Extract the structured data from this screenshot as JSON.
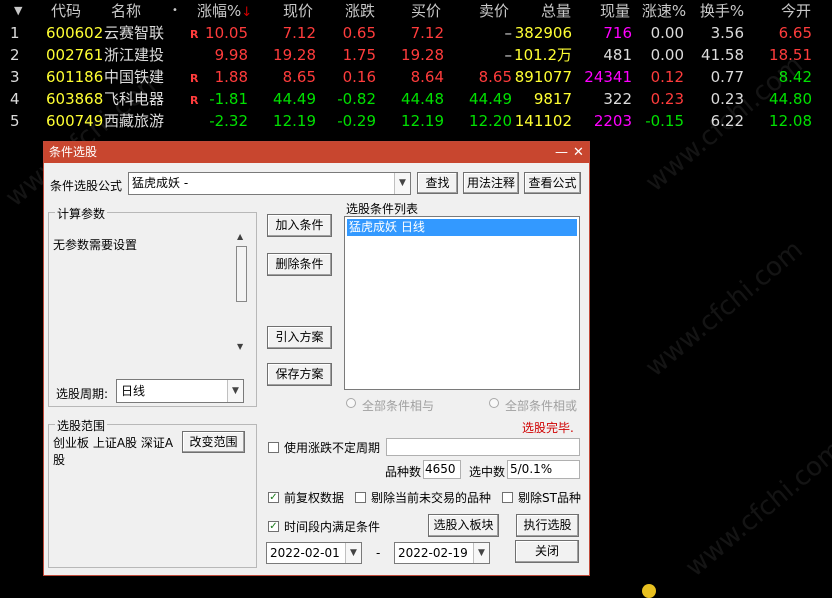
{
  "quote_table": {
    "headers": {
      "code": "代码",
      "name": "名称",
      "change_pct": "涨幅%",
      "price": "现价",
      "change": "涨跌",
      "bid": "买价",
      "ask": "卖价",
      "volume": "总量",
      "cur_vol": "现量",
      "speed": "涨速%",
      "turnover": "换手%",
      "open": "今开"
    },
    "sort_marker": "↓",
    "rows": [
      {
        "idx": "1",
        "code": "600602",
        "name": "云赛智联",
        "flag": "R",
        "change_pct": "10.05",
        "price": "7.12",
        "change": "0.65",
        "bid": "7.12",
        "ask": "–",
        "volume": "382906",
        "cur_vol": "716",
        "speed": "0.00",
        "turnover": "3.56",
        "open": "6.65"
      },
      {
        "idx": "2",
        "code": "002761",
        "name": "浙江建投",
        "flag": "",
        "change_pct": "9.98",
        "price": "19.28",
        "change": "1.75",
        "bid": "19.28",
        "ask": "–",
        "volume": "101.2万",
        "cur_vol": "481",
        "speed": "0.00",
        "turnover": "41.58",
        "open": "18.51"
      },
      {
        "idx": "3",
        "code": "601186",
        "name": "中国铁建",
        "flag": "R",
        "change_pct": "1.88",
        "price": "8.65",
        "change": "0.16",
        "bid": "8.64",
        "ask": "8.65",
        "volume": "891077",
        "cur_vol": "24341",
        "speed": "0.12",
        "turnover": "0.77",
        "open": "8.42"
      },
      {
        "idx": "4",
        "code": "603868",
        "name": "飞科电器",
        "flag": "R",
        "change_pct": "-1.81",
        "price": "44.49",
        "change": "-0.82",
        "bid": "44.48",
        "ask": "44.49",
        "volume": "9817",
        "cur_vol": "322",
        "speed": "0.23",
        "turnover": "0.23",
        "open": "44.80"
      },
      {
        "idx": "5",
        "code": "600749",
        "name": "西藏旅游",
        "flag": "",
        "change_pct": "-2.32",
        "price": "12.19",
        "change": "-0.29",
        "bid": "12.19",
        "ask": "12.20",
        "volume": "141102",
        "cur_vol": "2203",
        "speed": "-0.15",
        "turnover": "6.22",
        "open": "12.08"
      }
    ]
  },
  "watermark": "www.cfchi.com",
  "dialog": {
    "title": "条件选股",
    "formula_label": "条件选股公式",
    "formula_value": "猛虎成妖      -",
    "find_button": "查找",
    "usage_button": "用法注释",
    "view_formula_button": "查看公式",
    "params_group": "计算参数",
    "params_text": "无参数需要设置",
    "period_label": "选股周期:",
    "period_value": "日线",
    "add_condition": "加入条件",
    "delete_condition": "删除条件",
    "import_scheme": "引入方案",
    "save_scheme": "保存方案",
    "cond_list_title": "选股条件列表",
    "cond_list_items": [
      "猛虎成妖  日线"
    ],
    "radio_and": "全部条件相与",
    "radio_or": "全部条件相或",
    "status": "选股完毕.",
    "scope_group": "选股范围",
    "scope_text": "创业板 上证A股 深证A股",
    "change_scope_button": "改变范围",
    "use_variable_period": "使用涨跌不定周期",
    "stock_count_label": "品种数",
    "stock_count_value": "4650",
    "selected_label": "选中数",
    "selected_value": "5/0.1%",
    "pre_adjust": "前复权数据",
    "exclude_untraded": "剔除当前未交易的品种",
    "exclude_st": "剔除ST品种",
    "time_range_condition": "时间段内满足条件",
    "add_to_block_button": "选股入板块",
    "execute_button": "执行选股",
    "close_button": "关闭",
    "date_from": "2022-02-01",
    "date_sep": "-",
    "date_to": "2022-02-19"
  },
  "colors": {
    "title_bar": "#c8462f",
    "selection": "#3399ff",
    "up": "#ff3c3c",
    "down": "#00e000",
    "code": "#ffff33"
  }
}
